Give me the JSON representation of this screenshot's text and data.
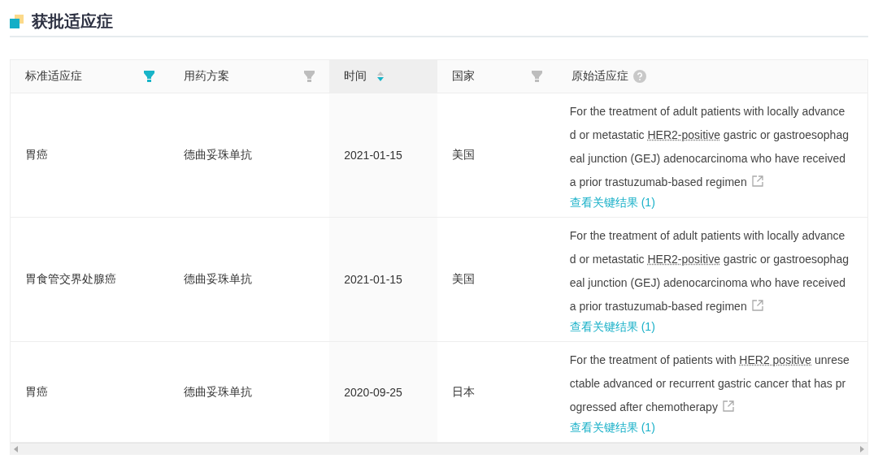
{
  "section": {
    "title": "获批适应症"
  },
  "table": {
    "columns": [
      {
        "label": "标准适应症",
        "kind": "filter",
        "active": true
      },
      {
        "label": "用药方案",
        "kind": "filter",
        "active": false
      },
      {
        "label": "时间",
        "kind": "sort",
        "active": true
      },
      {
        "label": "国家",
        "kind": "filter",
        "active": false
      },
      {
        "label": "原始适应症",
        "kind": "help"
      }
    ],
    "rows": [
      {
        "indication": "胃癌",
        "regimen": "德曲妥珠单抗",
        "date": "2021-01-15",
        "country": "美国",
        "original": {
          "before": "For the treatment of adult patients with locally advanced or metastatic ",
          "term": "HER2-positive",
          "after": " gastric or gastroesophageal junction (GEJ) adenocarcinoma who have received a prior trastuzumab-based regimen"
        },
        "link": "查看关键结果 (1)"
      },
      {
        "indication": "胃食管交界处腺癌",
        "regimen": "德曲妥珠单抗",
        "date": "2021-01-15",
        "country": "美国",
        "original": {
          "before": "For the treatment of adult patients with locally advanced or metastatic ",
          "term": "HER2-positive",
          "after": " gastric or gastroesophageal junction (GEJ) adenocarcinoma who have received a prior trastuzumab-based regimen"
        },
        "link": "查看关键结果 (1)"
      },
      {
        "indication": "胃癌",
        "regimen": "德曲妥珠单抗",
        "date": "2020-09-25",
        "country": "日本",
        "original": {
          "before": "For the treatment of patients with ",
          "term": "HER2 positive",
          "after": " unresectable advanced or recurrent gastric cancer that has progressed after chemotherapy"
        },
        "link": "查看关键结果 (1)"
      }
    ]
  }
}
